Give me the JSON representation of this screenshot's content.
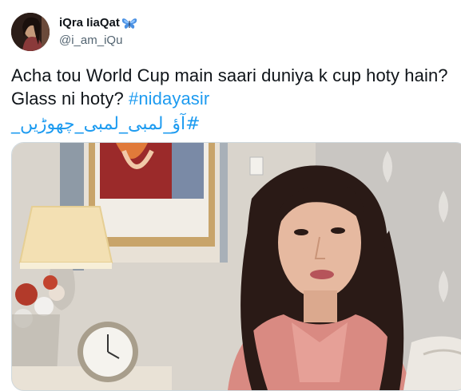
{
  "tweet": {
    "author": {
      "display_name": "iQra IiaQat",
      "handle": "@i_am_iQu",
      "name_emoji_icon": "butterfly-icon",
      "avatar_icon": "profile-avatar"
    },
    "text": {
      "line1": "Acha tou World Cup main saari duniya k cup hoty hain?",
      "line2_plain": "Glass ni hoty? ",
      "hashtag1": "#nidayasir",
      "hashtag2": "#آؤ_لمبی_لمبی_چھوڑیں_"
    },
    "media": {
      "type": "photo",
      "description_icon": "video-still-woman-pink-outfit"
    }
  },
  "colors": {
    "text": "#0f1419",
    "secondary": "#536471",
    "link": "#1d9bf0",
    "border": "#cfd9de"
  }
}
